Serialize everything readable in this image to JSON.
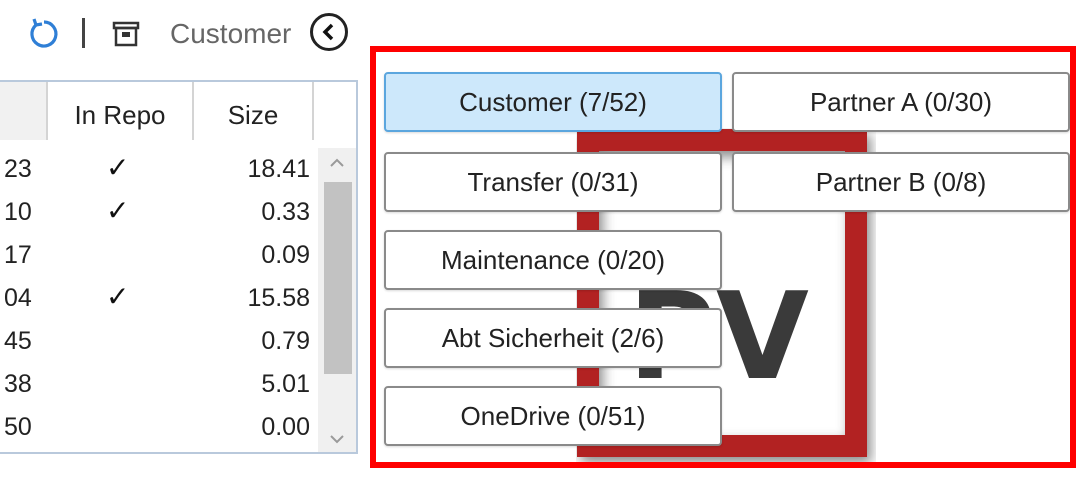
{
  "toolbar": {
    "refresh_icon": "refresh-icon",
    "archive_icon": "archive-icon",
    "label": "Customer",
    "collapse_icon": "chevron-left-icon"
  },
  "table": {
    "columns": [
      "",
      "In Repo",
      "Size"
    ],
    "rows": [
      {
        "id": "23",
        "in_repo": "✓",
        "size": "18.41"
      },
      {
        "id": "10",
        "in_repo": "✓",
        "size": "0.33"
      },
      {
        "id": "17",
        "in_repo": "",
        "size": "0.09"
      },
      {
        "id": "04",
        "in_repo": "✓",
        "size": "15.58"
      },
      {
        "id": "45",
        "in_repo": "",
        "size": "0.79"
      },
      {
        "id": "38",
        "in_repo": "",
        "size": "5.01"
      },
      {
        "id": "50",
        "in_repo": "",
        "size": "0.00"
      }
    ]
  },
  "categories": [
    {
      "label": "Customer (7/52)",
      "selected": true
    },
    {
      "label": "Partner A (0/30)",
      "selected": false
    },
    {
      "label": "Transfer (0/31)",
      "selected": false
    },
    {
      "label": "Partner B (0/8)",
      "selected": false
    },
    {
      "label": "Maintenance (0/20)",
      "selected": false
    },
    {
      "label": "Abt Sicherheit (2/6)",
      "selected": false
    },
    {
      "label": "OneDrive (0/51)",
      "selected": false
    }
  ],
  "colors": {
    "accent": "#2f7fd6",
    "selected_bg": "#cde8fb",
    "highlight_border": "#ff0000",
    "logo_red": "#b22222"
  }
}
